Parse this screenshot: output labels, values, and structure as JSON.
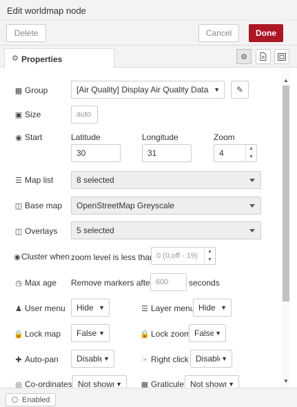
{
  "window": {
    "title": "Edit worldmap node"
  },
  "actions": {
    "delete_label": "Delete",
    "cancel_label": "Cancel",
    "done_label": "Done"
  },
  "tabs": {
    "properties_label": "Properties"
  },
  "form": {
    "group": {
      "label": "Group",
      "value": "[Air Quality] Display Air Quality Data"
    },
    "size": {
      "label": "Size",
      "value": "auto"
    },
    "start": {
      "label": "Start",
      "latitude_label": "Latitude",
      "latitude_value": "30",
      "longitude_label": "Longitude",
      "longitude_value": "31",
      "zoom_label": "Zoom",
      "zoom_value": "4"
    },
    "maplist": {
      "label": "Map list",
      "value": "8 selected"
    },
    "basemap": {
      "label": "Base map",
      "value": "OpenStreetMap Greyscale"
    },
    "overlays": {
      "label": "Overlays",
      "value": "5 selected"
    },
    "cluster": {
      "label": "Cluster when",
      "text": "zoom level is less than",
      "placeholder": "0 (0,off - 19)"
    },
    "maxage": {
      "label": "Max age",
      "text": "Remove markers after",
      "placeholder": "600",
      "unit": "seconds"
    },
    "usermenu": {
      "label": "User menu",
      "value": "Hide"
    },
    "layermenu": {
      "label": "Layer menu",
      "value": "Hide"
    },
    "lockmap": {
      "label": "Lock map",
      "value": "False"
    },
    "lockzoom": {
      "label": "Lock zoom",
      "value": "False"
    },
    "autopan": {
      "label": "Auto-pan",
      "value": "Disable"
    },
    "rightclick": {
      "label": "Right click",
      "value": "Disable"
    },
    "coordinates": {
      "label": "Co-ordinates",
      "value": "Not shown"
    },
    "graticule": {
      "label": "Graticule",
      "value": "Not shown"
    }
  },
  "footer": {
    "enabled_label": "Enabled"
  },
  "colors": {
    "primary": "#ad1625"
  }
}
